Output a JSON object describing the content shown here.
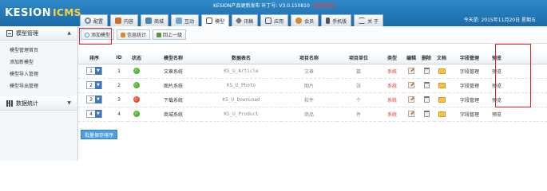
{
  "header": {
    "logo": "KESION",
    "logo_accent": "ICMS",
    "announcement": "KESION产品更新发布 补丁号: V3.0.150810",
    "version_tag": "[最新版本]",
    "today": "今天是: 2015年11月20日 星期五",
    "tabs": [
      {
        "label": "配置",
        "icon": "gear-icon"
      },
      {
        "label": "内容",
        "icon": "home-icon"
      },
      {
        "label": "商城",
        "icon": "cart-icon"
      },
      {
        "label": "互动",
        "icon": "chat-icon"
      },
      {
        "label": "模型",
        "icon": "grid-icon",
        "active": true
      },
      {
        "label": "讯稿",
        "icon": "tag-icon"
      },
      {
        "label": "应用",
        "icon": "app-icon"
      },
      {
        "label": "会员",
        "icon": "user-icon"
      },
      {
        "label": "手机版",
        "icon": "phone-icon"
      },
      {
        "label": "关 于",
        "icon": "menu-icon"
      }
    ]
  },
  "sidebar": {
    "section1_title": "模型管理",
    "items": [
      "模型管理首页",
      "添加新模型",
      "模型导入管理",
      "模型导出管理"
    ],
    "section2_title": "数据统计"
  },
  "toolbar": {
    "add_model": "添加模型",
    "info_stats": "信息统计",
    "back_up": "回上一级"
  },
  "table": {
    "headers": [
      "排序",
      "ID",
      "状态",
      "模型名称",
      "数据表名",
      "项目名称",
      "项目单位",
      "类型",
      "编辑",
      "删除",
      "文档",
      "字段管理",
      "预览"
    ],
    "rows": [
      {
        "order": "1",
        "id": "1",
        "status": "on",
        "name": "文章系统",
        "table": "KS_U_Article",
        "item": "文章",
        "unit": "篇",
        "type": "系统",
        "field": "字段管理",
        "preview": "预览"
      },
      {
        "order": "2",
        "id": "2",
        "status": "on",
        "name": "图片系统",
        "table": "KS_U_Photo",
        "item": "图片",
        "unit": "张",
        "type": "系统",
        "field": "字段管理",
        "preview": "预览"
      },
      {
        "order": "3",
        "id": "3",
        "status": "off",
        "name": "下载系统",
        "table": "KS_U_DownLoad",
        "item": "软件",
        "unit": "个",
        "type": "系统",
        "field": "字段管理",
        "preview": "预览"
      },
      {
        "order": "4",
        "id": "4",
        "status": "on",
        "name": "商城系统",
        "table": "KS_U_Product",
        "item": "商品",
        "unit": "件",
        "type": "系统",
        "field": "字段管理",
        "preview": "预览"
      }
    ]
  },
  "batch_save": "批量保存排序"
}
